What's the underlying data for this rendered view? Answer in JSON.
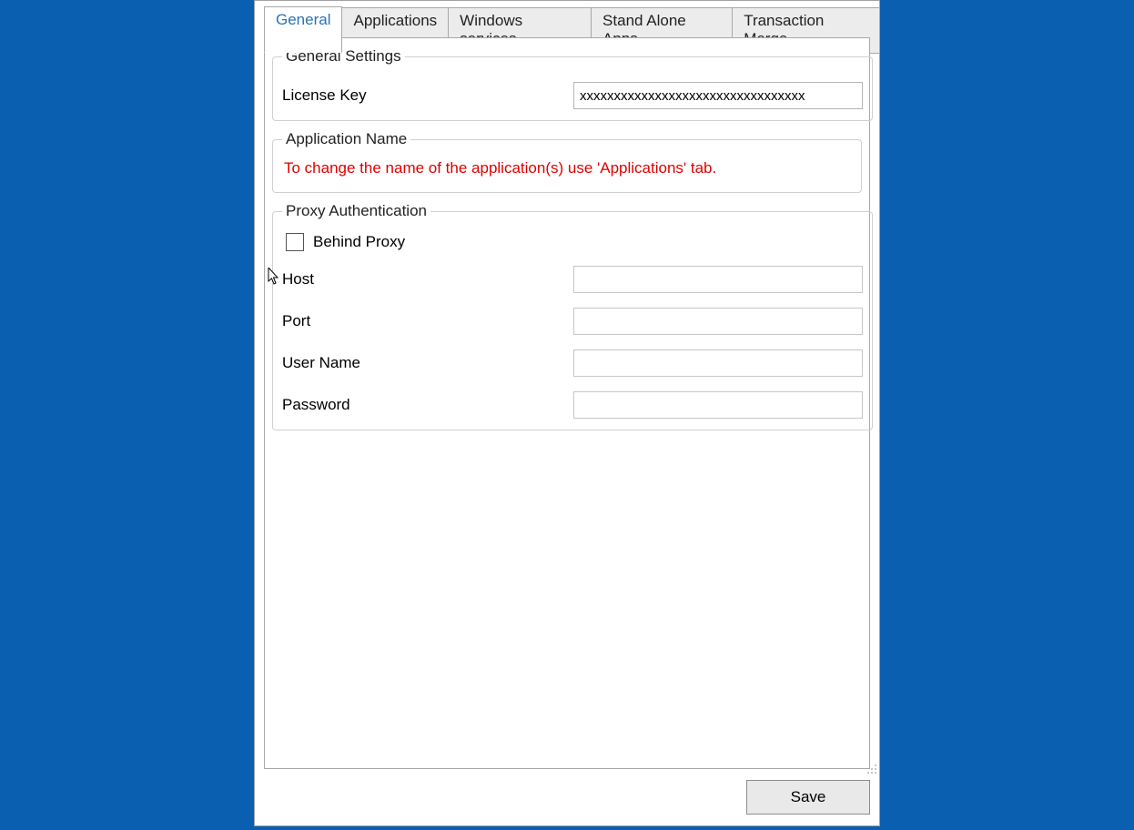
{
  "tabs": {
    "general": "General",
    "applications": "Applications",
    "windows_services": "Windows services",
    "standalone": "Stand Alone Apps",
    "txn_merge": "Transaction Merge"
  },
  "general_settings": {
    "legend": "General Settings",
    "license_key_label": "License Key",
    "license_key_value": "xxxxxxxxxxxxxxxxxxxxxxxxxxxxxxxxx"
  },
  "app_name": {
    "legend": "Application Name",
    "note": "To change the name of the application(s) use 'Applications' tab."
  },
  "proxy": {
    "legend": "Proxy Authentication",
    "behind_proxy_label": "Behind Proxy",
    "behind_proxy_checked": false,
    "host_label": "Host",
    "host_value": "",
    "port_label": "Port",
    "port_value": "",
    "user_label": "User Name",
    "user_value": "",
    "password_label": "Password",
    "password_value": ""
  },
  "buttons": {
    "save": "Save"
  }
}
